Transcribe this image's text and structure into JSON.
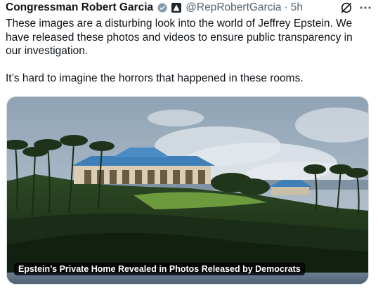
{
  "author": {
    "display_name": "Congressman Robert Garcia",
    "handle": "@RepRobertGarcia",
    "separator": "·",
    "time": "5h",
    "verified_color": "#829aab"
  },
  "icons": {
    "verified": "verified-badge-icon",
    "affiliate": "government-affiliate-icon",
    "grok": "grok-icon",
    "more": "more-options-icon"
  },
  "tweet": {
    "paragraph1": "These images are a disturbing look into the world of Jeffrey Epstein. We have released these photos and videos to ensure public transparency in our investigation.",
    "paragraph2": "It’s hard to imagine the horrors that happened in these rooms."
  },
  "media": {
    "caption": "Epstein’s Private Home Revealed in Photos Released by Democrats",
    "colors": {
      "sky": "#a9b8c6",
      "cloud": "#d9e0e6",
      "roof": "#3f7fb8",
      "hill": "#1f3a1c",
      "lawn": "#6e9a3e",
      "water": "#5d7487"
    }
  }
}
